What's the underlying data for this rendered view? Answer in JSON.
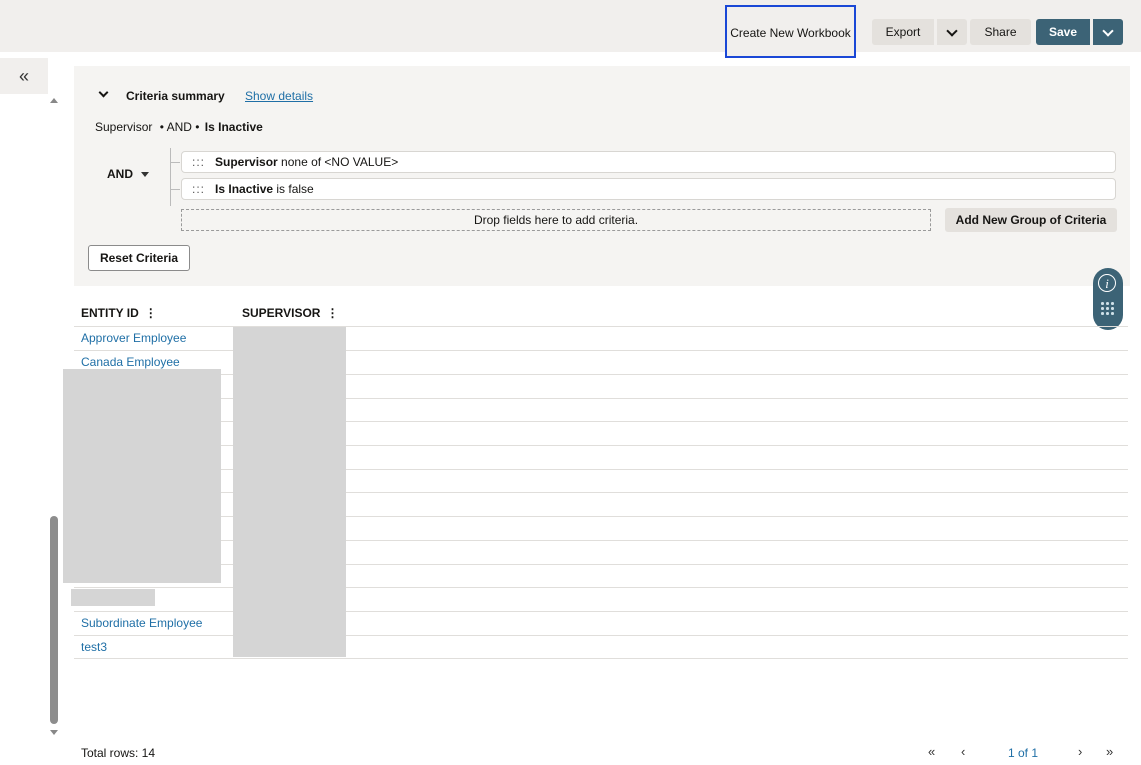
{
  "toolbar": {
    "create_new_workbook": "Create New Workbook",
    "export": "Export",
    "share": "Share",
    "save": "Save"
  },
  "left_rail": {
    "collapse_icon": "«"
  },
  "criteria": {
    "title": "Criteria summary",
    "show_details": "Show details",
    "summary": {
      "field1": "Supervisor",
      "op": "• AND •",
      "field2": "Is Inactive"
    },
    "group_operator": "AND",
    "rows": [
      {
        "grip": ":::",
        "field": "Supervisor",
        "condition": " none of <NO VALUE>"
      },
      {
        "grip": ":::",
        "field": "Is Inactive",
        "condition": " is false"
      }
    ],
    "drop_zone": "Drop fields here to add criteria.",
    "add_group": "Add New Group of Criteria",
    "reset": "Reset Criteria"
  },
  "table": {
    "columns": [
      {
        "label": "ENTITY ID",
        "menu": "⋮"
      },
      {
        "label": "SUPERVISOR",
        "menu": "⋮"
      }
    ],
    "rows": [
      {
        "entity_id": "Approver Employee"
      },
      {
        "entity_id": "Canada Employee"
      },
      {
        "entity_id": ""
      },
      {
        "entity_id": ""
      },
      {
        "entity_id": ""
      },
      {
        "entity_id": ""
      },
      {
        "entity_id": ""
      },
      {
        "entity_id": ""
      },
      {
        "entity_id": ""
      },
      {
        "entity_id": ""
      },
      {
        "entity_id": ""
      },
      {
        "entity_id": ""
      },
      {
        "entity_id": "Subordinate Employee"
      },
      {
        "entity_id": "test3"
      }
    ]
  },
  "footer": {
    "total_rows": "Total rows: 14",
    "first": "«",
    "prev": "‹",
    "page": "1 of 1",
    "next": "›",
    "last": "»"
  },
  "colors": {
    "accent": "#3c6376",
    "link": "#1f6fa6",
    "highlight_border": "#1a47d6"
  },
  "icons": {
    "info": "info-icon",
    "grip": "drag-grip-icon",
    "collapse": "double-chevron-left-icon"
  }
}
